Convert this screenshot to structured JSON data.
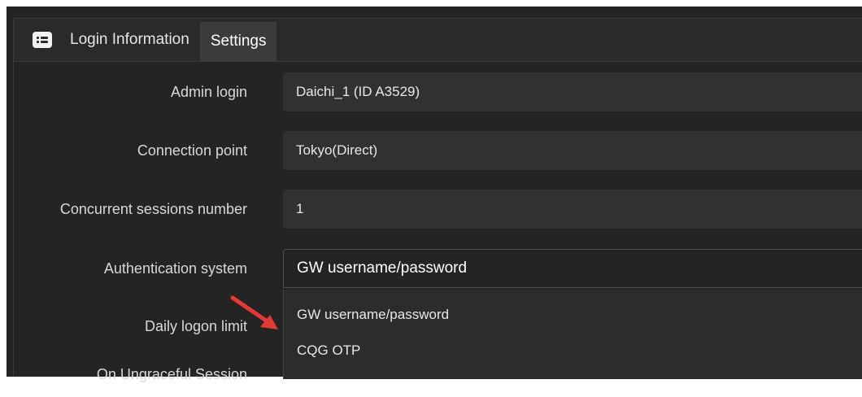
{
  "tabs": [
    {
      "label": "Login Information",
      "active": false
    },
    {
      "label": "Settings",
      "active": true
    }
  ],
  "tab_icon": "list-icon",
  "rows": [
    {
      "label": "Admin login",
      "value": "Daichi_1 (ID A3529)"
    },
    {
      "label": "Connection point",
      "value": "Tokyo(Direct)"
    },
    {
      "label": "Concurrent sessions number",
      "value": "1"
    },
    {
      "label": "Authentication system",
      "value": "GW username/password"
    },
    {
      "label": "Daily logon limit"
    },
    {
      "label": "On Ungraceful Session"
    }
  ],
  "auth_dropdown": {
    "options": [
      "GW username/password",
      "CQG OTP"
    ]
  },
  "colors": {
    "panel_bg": "#242424",
    "field_bg": "#313131",
    "arrow": "#e53935"
  }
}
